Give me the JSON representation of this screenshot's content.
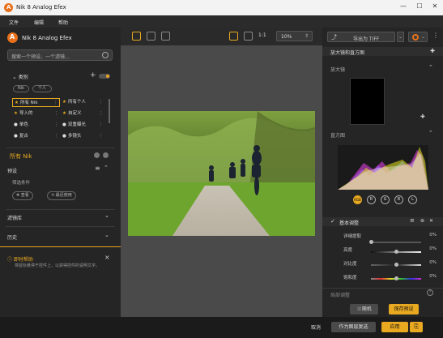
{
  "window": {
    "title": "Nik 8 Analog Efex",
    "controls": [
      "—",
      "☐",
      "✕"
    ]
  },
  "menu": [
    "文件",
    "编辑",
    "帮助"
  ],
  "left": {
    "brand": "Nik 8 Analog Efex",
    "search_placeholder": "搜索一个预设、一个滤镜...",
    "categories_label": "类别",
    "chips": [
      "Nik",
      "个人"
    ],
    "grid": [
      {
        "label": "所有 Nik",
        "selected": true,
        "icon": "star-icon"
      },
      {
        "label": "所有个人",
        "selected": false,
        "icon": "star-icon"
      },
      {
        "label": "导入的",
        "selected": false,
        "icon": "star-icon"
      },
      {
        "label": "自定义",
        "selected": false,
        "icon": "star-icon"
      },
      {
        "label": "单色",
        "selected": false,
        "icon": "dot-icon"
      },
      {
        "label": "双重曝光",
        "selected": false,
        "icon": "dot-icon"
      },
      {
        "label": "复古",
        "selected": false,
        "icon": "dot-icon"
      },
      {
        "label": "多镜头",
        "selected": false,
        "icon": "dot-icon"
      }
    ],
    "all_nik": "所有 Nik",
    "presets_label": "预设",
    "add_condition": "筛选条件",
    "pill_view": "查看",
    "pill_recent": "最近使用",
    "filmstrip_label": "滤镜库",
    "history_label": "历史",
    "help_title": "即时帮助",
    "help_text": "将鼠标悬停于控件上，以获得控件的说明文字。"
  },
  "center": {
    "zoom_value": "10%",
    "ratio_label": "1:1"
  },
  "right": {
    "export_label": "导出为 TIFF",
    "loupe_title": "放大镜和直方图",
    "loupe_label": "放大镜",
    "histogram_label": "直方图",
    "channels": [
      "RGB",
      "R",
      "G",
      "B",
      "L"
    ],
    "basic_title": "基本调整",
    "sliders": [
      {
        "label": "详细提取",
        "value": "0%",
        "pos": 0
      },
      {
        "label": "亮度",
        "value": "0%",
        "pos": 0.5
      },
      {
        "label": "对比度",
        "value": "0%",
        "pos": 0.5
      },
      {
        "label": "饱和度",
        "value": "0%",
        "pos": 0.5
      }
    ],
    "next_section": "局部调整",
    "random_label": "随机",
    "save_preset_label": "保存预设"
  },
  "bottom": {
    "cancel": "取消",
    "copy_layer": "作为图层复选",
    "apply": "应用"
  },
  "colors": {
    "accent": "#e8a820",
    "brand": "#e8701a"
  }
}
